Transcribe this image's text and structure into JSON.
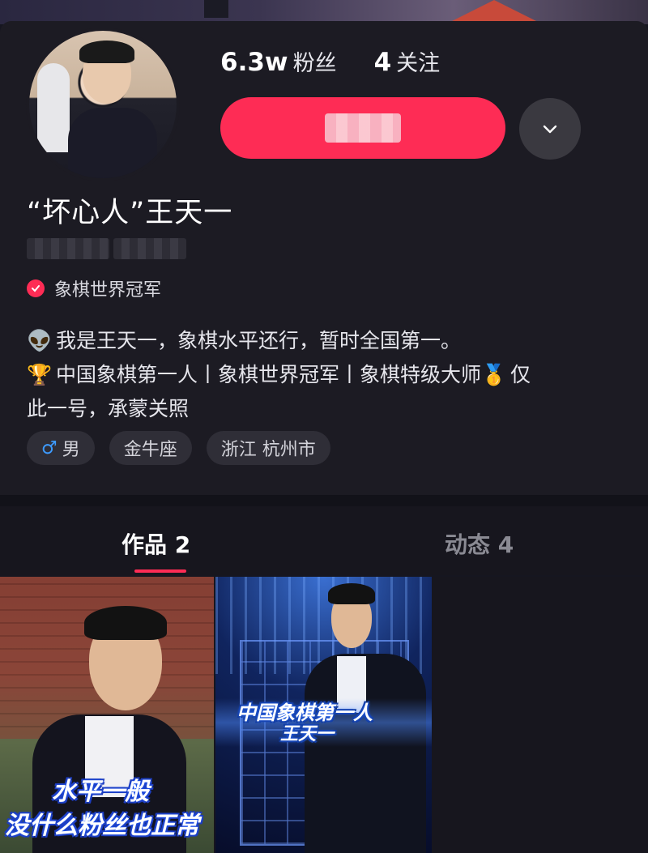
{
  "profile": {
    "followers_count": "6.3w",
    "followers_label": "粉丝",
    "following_count": "4",
    "following_label": "关注",
    "name": "“坏心人”王天一",
    "verification": "象棋世界冠军",
    "bio_line1": "我是王天一，象棋水平还行，暂时全国第一。",
    "bio_line2": "中国象棋第一人丨象棋世界冠军丨象棋特级大师",
    "bio_line2_tail": "仅",
    "bio_line3": "此一号，承蒙关照",
    "bio_icon1": "👽",
    "bio_icon2": "🏆",
    "bio_icon3": "🥇",
    "tags": {
      "gender_symbol": "♂",
      "gender": "男",
      "zodiac": "金牛座",
      "location": "浙江 杭州市"
    }
  },
  "tabs": {
    "works": "作品 2",
    "moments": "动态 4"
  },
  "videos": {
    "v1_caption_line1": "水平一般",
    "v1_caption_line2": "没什么粉丝也正常",
    "v2_caption_line1": "中国象棋第一人",
    "v2_caption_line2": "王天一"
  },
  "colors": {
    "accent": "#fe2c55",
    "background": "#1c1b23"
  },
  "icons": {
    "more": "chevron-down-icon",
    "verified": "verified-check-icon"
  }
}
